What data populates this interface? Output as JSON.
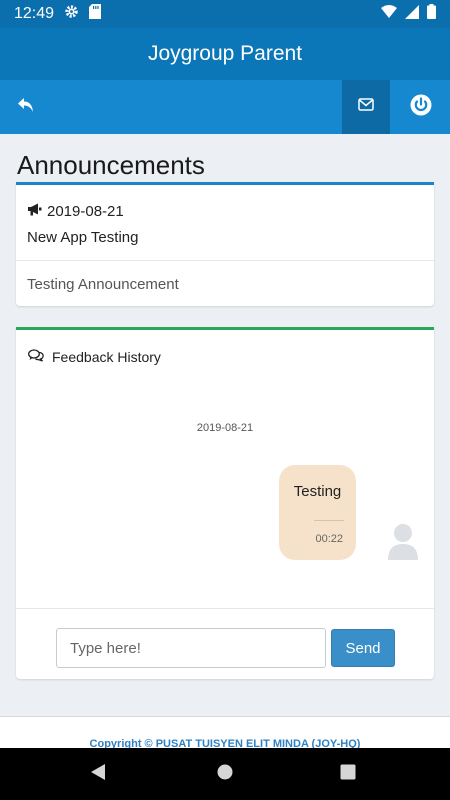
{
  "status_bar": {
    "time": "12:49",
    "icons": [
      "gear-icon",
      "sd-card-icon",
      "wifi-icon",
      "signal-icon",
      "battery-icon"
    ]
  },
  "app": {
    "title_brand": "Joygroup",
    "title_suffix": " Parent"
  },
  "toolbar": {
    "back_icon": "reply-icon",
    "mail_icon": "envelope-icon",
    "power_icon": "power-icon"
  },
  "announcements": {
    "heading": "Announcements",
    "items": [
      {
        "icon": "megaphone-icon",
        "date": "2019-08-21",
        "subject": "New App Testing",
        "body": "Testing Announcement"
      }
    ]
  },
  "feedback": {
    "header_icon": "comments-icon",
    "title": "Feedback History",
    "date": "2019-08-21",
    "messages": [
      {
        "text": "Testing",
        "time": "00:22"
      }
    ],
    "input_placeholder": "Type here!",
    "send_label": "Send"
  },
  "footer": {
    "copyright": "Copyright © PUSAT TUISYEN ELIT MINDA (JOY-HQ)"
  },
  "colors": {
    "status_bar": "#0b6fae",
    "header": "#0c77b8",
    "toolbar": "#1688cf",
    "ann_accent": "#1a86c7",
    "feedback_accent": "#2aa65b",
    "bubble": "#f6e2cb",
    "send": "#3a8fc8"
  }
}
